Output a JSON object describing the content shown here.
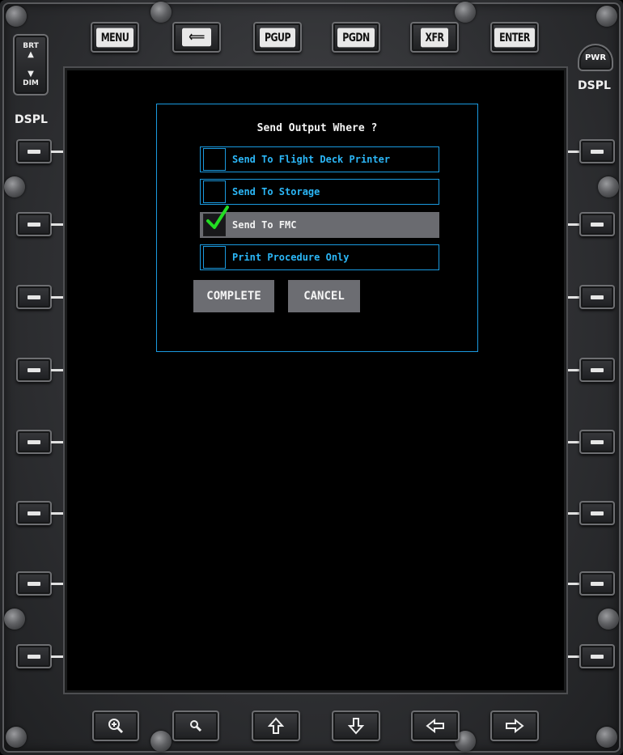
{
  "top_keys": {
    "menu": "MENU",
    "back_icon": "back-arrow-icon",
    "pgup": "PGUP",
    "pgdn": "PGDN",
    "xfr": "XFR",
    "enter": "ENTER"
  },
  "left_panel": {
    "brt": "BRT",
    "dim": "DIM",
    "dspl": "DSPL"
  },
  "right_panel": {
    "pwr": "PWR",
    "dspl": "DSPL"
  },
  "dialog": {
    "title": "Send Output Where ?",
    "options": [
      {
        "label": "Send To Flight Deck Printer",
        "checked": false
      },
      {
        "label": "Send To Storage",
        "checked": false
      },
      {
        "label": "Send To FMC",
        "checked": true
      },
      {
        "label": "Print Procedure Only",
        "checked": false
      }
    ],
    "complete_label": "COMPLETE",
    "cancel_label": "CANCEL"
  },
  "bottom_keys": {
    "icons": [
      "zoom-in-icon",
      "zoom-out-icon",
      "arrow-up-icon",
      "arrow-down-icon",
      "arrow-left-icon",
      "arrow-right-icon"
    ]
  },
  "colors": {
    "accent": "#1a9ae0",
    "option_text": "#2bb6f6",
    "checked_bg": "#6a6b70",
    "check_mark": "#22dd22",
    "button_bg": "#6c6d72"
  }
}
